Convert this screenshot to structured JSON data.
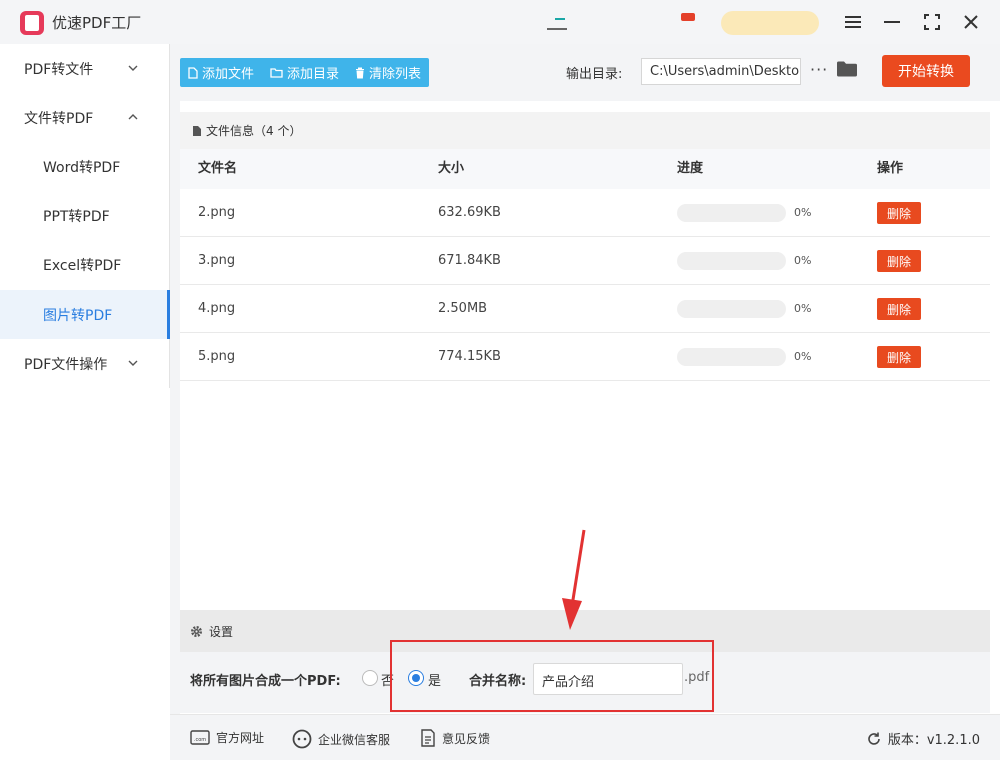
{
  "app": {
    "title": "优速PDF工厂"
  },
  "sidebar": {
    "items": [
      {
        "label": "PDF转文件",
        "expanded": false
      },
      {
        "label": "文件转PDF",
        "expanded": true
      },
      {
        "label": "Word转PDF"
      },
      {
        "label": "PPT转PDF"
      },
      {
        "label": "Excel转PDF"
      },
      {
        "label": "图片转PDF",
        "active": true
      },
      {
        "label": "PDF文件操作",
        "expanded": false
      }
    ]
  },
  "toolbar": {
    "add_file": "添加文件",
    "add_dir": "添加目录",
    "clear_list": "清除列表",
    "output_label": "输出目录:",
    "output_path": "C:\\Users\\admin\\Deskto",
    "more": "···",
    "start": "开始转换"
  },
  "file_info": {
    "title": "文件信息（4 个）"
  },
  "table": {
    "headers": [
      "文件名",
      "大小",
      "进度",
      "操作"
    ],
    "rows": [
      {
        "name": "2.png",
        "size": "632.69KB",
        "progress": "0%",
        "action": "删除"
      },
      {
        "name": "3.png",
        "size": "671.84KB",
        "progress": "0%",
        "action": "删除"
      },
      {
        "name": "4.png",
        "size": "2.50MB",
        "progress": "0%",
        "action": "删除"
      },
      {
        "name": "5.png",
        "size": "774.15KB",
        "progress": "0%",
        "action": "删除"
      }
    ]
  },
  "settings": {
    "title": "设置",
    "merge_label": "将所有图片合成一个PDF:",
    "option_no": "否",
    "option_yes": "是",
    "selected": "是",
    "name_label": "合并名称:",
    "name_value": "产品介绍",
    "ext": ".pdf"
  },
  "footer": {
    "website": "官方网址",
    "wechat": "企业微信客服",
    "feedback": "意见反馈",
    "version": "版本：v1.2.1.0"
  },
  "colors": {
    "accent": "#2a7ee0",
    "toolbar_btn": "#3fb4ea",
    "danger": "#e84a1f",
    "highlight": "#e23232"
  }
}
